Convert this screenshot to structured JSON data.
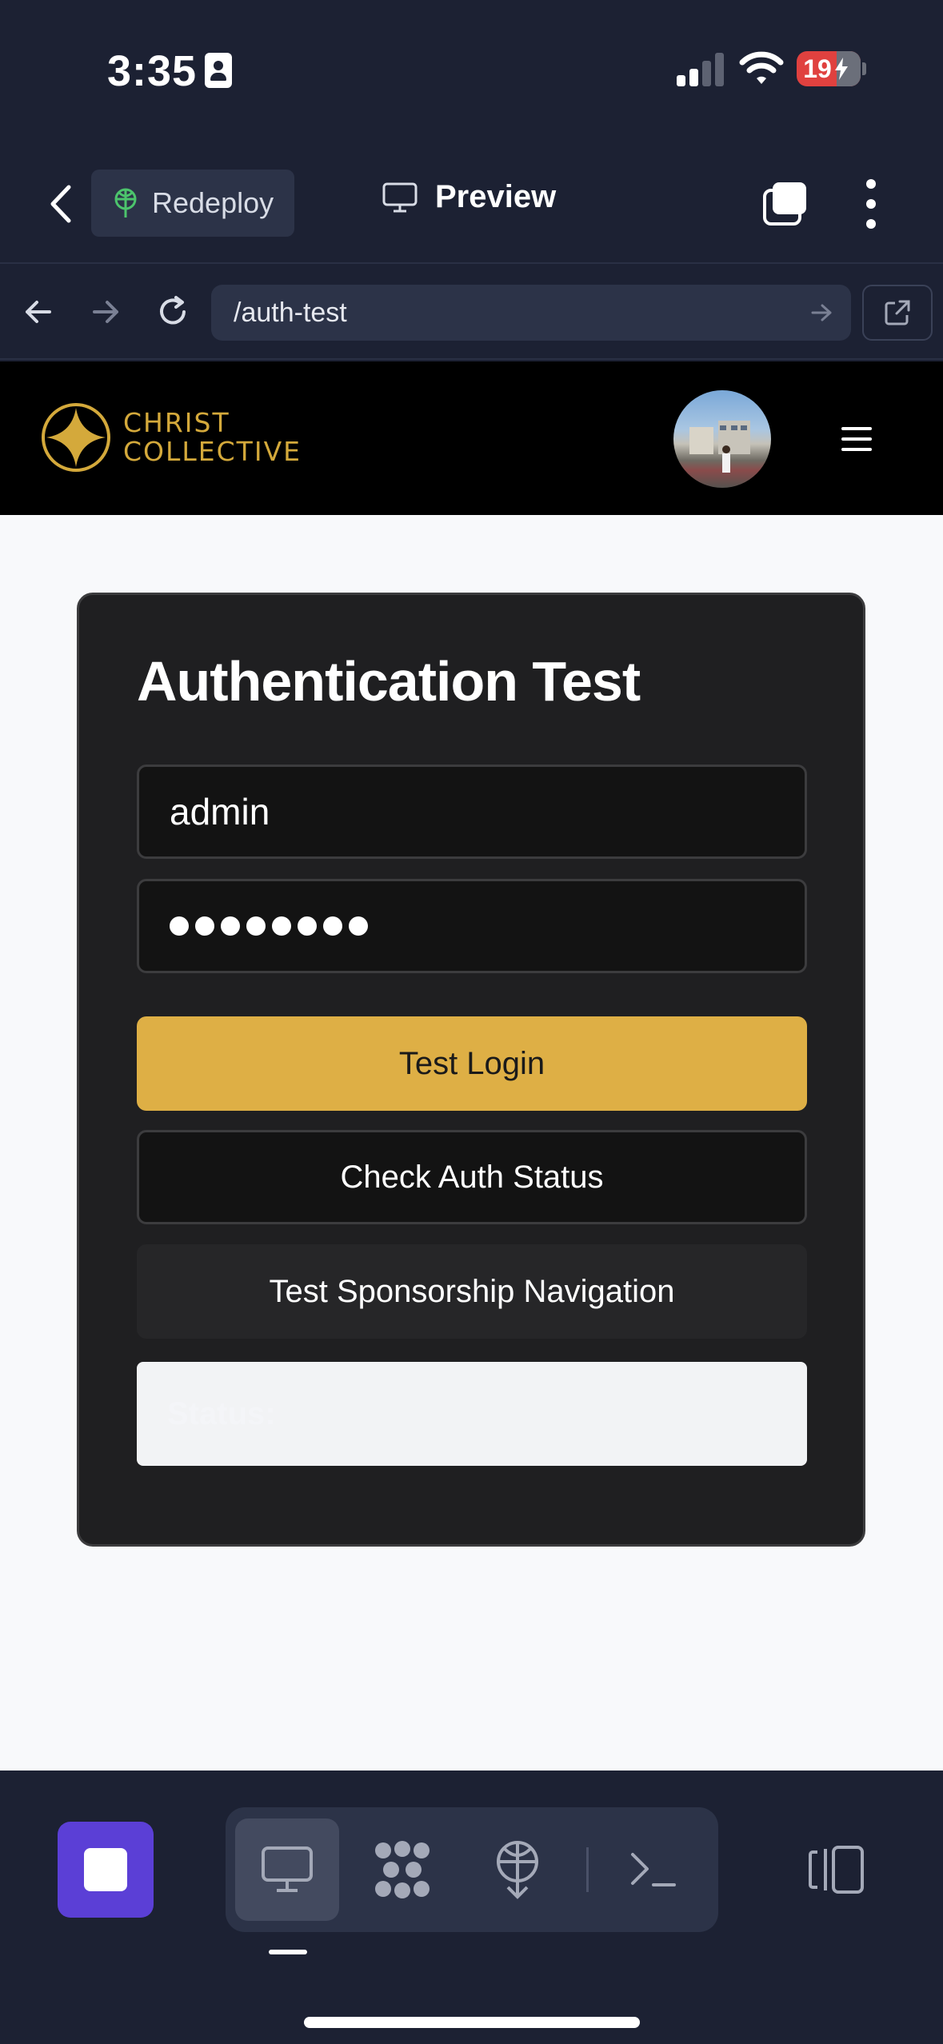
{
  "status_bar": {
    "time": "3:35",
    "battery": "19"
  },
  "app_bar": {
    "redeploy_label": "Redeploy",
    "preview_label": "Preview"
  },
  "browser": {
    "url": "/auth-test"
  },
  "site": {
    "logo_line1": "CHRIST",
    "logo_line2": "COLLECTIVE"
  },
  "auth_card": {
    "title": "Authentication Test",
    "username_value": "admin",
    "password_mask_length": 8,
    "login_button": "Test Login",
    "check_button": "Check Auth Status",
    "sponsor_button": "Test Sponsorship Navigation",
    "status_label": "Status:"
  },
  "colors": {
    "accent_gold": "#deaf45",
    "stop_purple": "#5b3fd6",
    "battery_red": "#e0413f"
  },
  "icons": [
    "back-chevron-icon",
    "redeploy-icon",
    "monitor-icon",
    "tabs-icon",
    "more-icon",
    "arrow-left-icon",
    "arrow-right-icon",
    "reload-icon",
    "go-arrow-icon",
    "external-link-icon",
    "logo-star-icon",
    "hamburger-icon",
    "stop-icon",
    "monitor-tool-icon",
    "cluster-tool-icon",
    "deploy-tool-icon",
    "terminal-tool-icon",
    "panel-icon"
  ]
}
